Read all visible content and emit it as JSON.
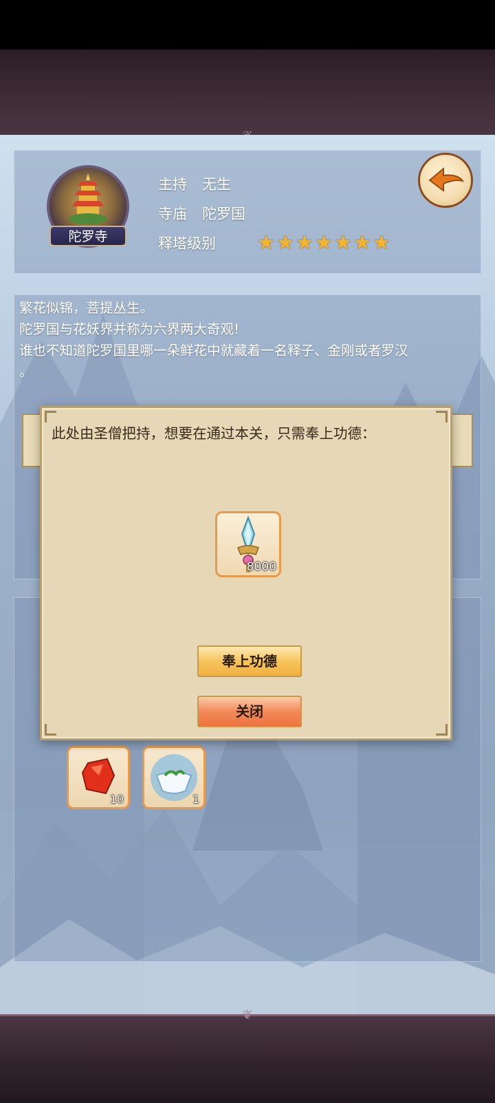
{
  "temple": {
    "emblem_label": "陀罗寺",
    "host_label": "主持",
    "host_value": "无生",
    "temple_label": "寺庙",
    "temple_value": "陀罗国",
    "level_label": "释塔级别",
    "stars": 7
  },
  "description": {
    "line1": "繁花似锦，菩提丛生。",
    "line2": "陀罗国与花妖界并称为六界两大奇观!",
    "line3": "谁也不知道陀罗国里哪一朵鲜花中就藏着一名释子、金刚或者罗汉",
    "line4": "。"
  },
  "dialog": {
    "message": "此处由圣僧把持，想要在通过本关，只需奉上功德：",
    "cost_item": {
      "icon": "merit-scepter-icon",
      "count": "8000"
    },
    "offer_button": "奉上功德",
    "close_button": "关闭"
  },
  "rewards": [
    {
      "icon": "red-gem-icon",
      "count": "10"
    },
    {
      "icon": "spirit-tea-bowl-icon",
      "count": "1"
    }
  ]
}
